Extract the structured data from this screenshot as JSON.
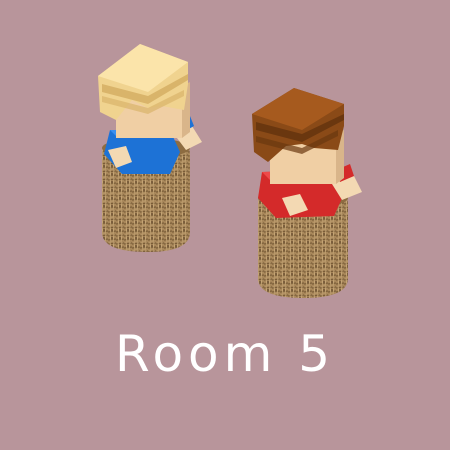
{
  "scene": {
    "background": "#b8959b",
    "title": "Room 5"
  },
  "characters": [
    {
      "name": "blond-player",
      "hair_color": "#f0d38f",
      "shirt_color": "#1d72d6",
      "sack": "burlap"
    },
    {
      "name": "brown-player",
      "hair_color": "#8a4a17",
      "shirt_color": "#d42a2a",
      "sack": "burlap"
    }
  ]
}
